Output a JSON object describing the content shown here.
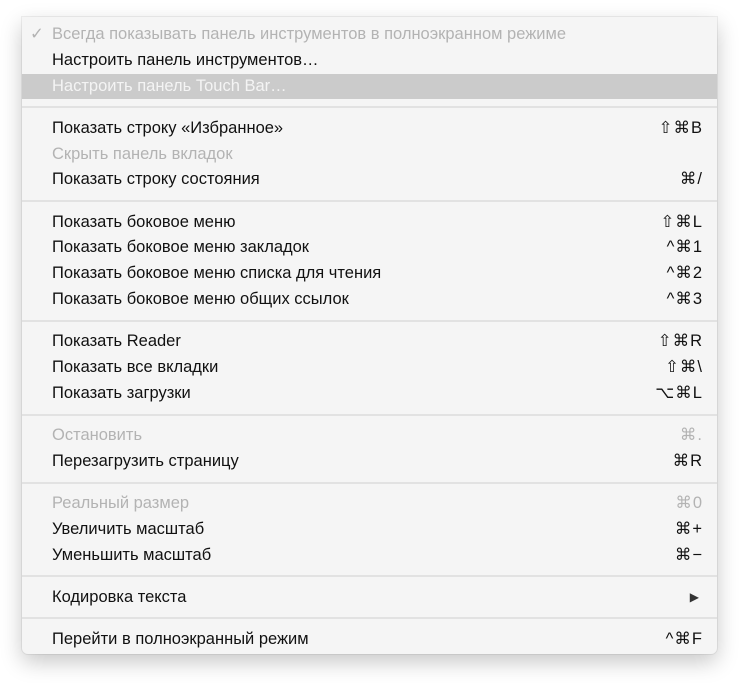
{
  "menu": {
    "items": [
      {
        "label": "Всегда показывать панель инструментов в полноэкранном режиме",
        "checked": true,
        "disabled": true,
        "check": "✓",
        "shortcut": ""
      },
      {
        "label": "Настроить панель инструментов…",
        "shortcut": ""
      },
      {
        "label": "Настроить панель Touch Bar…",
        "highlighted": true,
        "shortcut": ""
      },
      {
        "sep": true
      },
      {
        "label": "Показать строку «Избранное»",
        "shortcut": "⇧⌘B"
      },
      {
        "label": "Скрыть панель вкладок",
        "disabled": true,
        "shortcut": ""
      },
      {
        "label": "Показать строку состояния",
        "shortcut": "⌘/"
      },
      {
        "sep": true
      },
      {
        "label": "Показать боковое меню",
        "shortcut": "⇧⌘L"
      },
      {
        "label": "Показать боковое меню закладок",
        "shortcut": "^⌘1"
      },
      {
        "label": "Показать боковое меню списка для чтения",
        "shortcut": "^⌘2"
      },
      {
        "label": "Показать боковое меню общих ссылок",
        "shortcut": "^⌘3"
      },
      {
        "sep": true
      },
      {
        "label": "Показать Reader",
        "shortcut": "⇧⌘R"
      },
      {
        "label": "Показать все вкладки",
        "shortcut": "⇧⌘\\"
      },
      {
        "label": "Показать загрузки",
        "shortcut": "⌥⌘L"
      },
      {
        "sep": true
      },
      {
        "label": "Остановить",
        "disabled": true,
        "shortcut": "⌘."
      },
      {
        "label": "Перезагрузить страницу",
        "shortcut": "⌘R"
      },
      {
        "sep": true
      },
      {
        "label": "Реальный размер",
        "disabled": true,
        "shortcut": "⌘0"
      },
      {
        "label": "Увеличить масштаб",
        "shortcut": "⌘+"
      },
      {
        "label": "Уменьшить масштаб",
        "shortcut": "⌘−"
      },
      {
        "sep": true
      },
      {
        "label": "Кодировка текста",
        "submenu": true,
        "arrow": "▶",
        "shortcut": ""
      },
      {
        "sep": true
      },
      {
        "label": "Перейти в полноэкранный режим",
        "shortcut": "^⌘F"
      }
    ]
  }
}
